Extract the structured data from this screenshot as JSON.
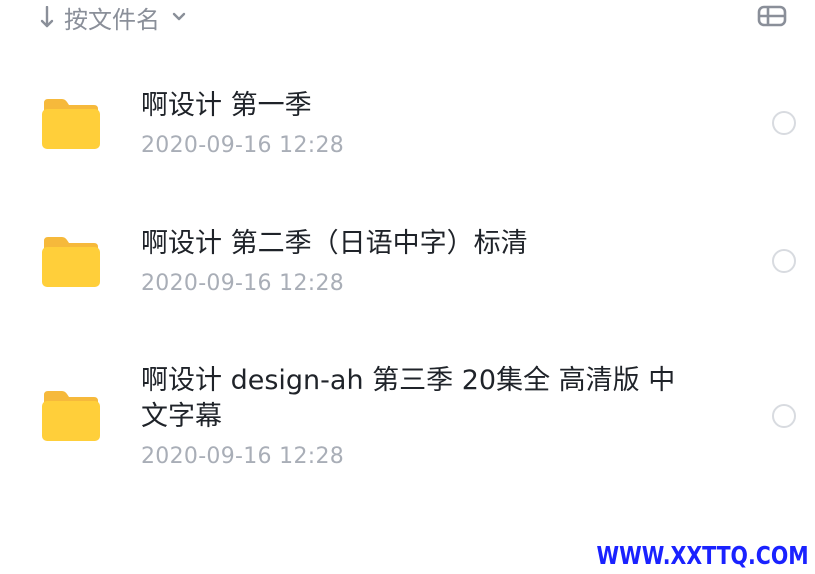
{
  "toolbar": {
    "sort_label": "按文件名",
    "sort_direction_icon": "arrow-down-icon",
    "sort_menu_icon": "chevron-down-icon",
    "view_toggle_icon": "list-view-icon"
  },
  "files": [
    {
      "name": "啊设计 第一季",
      "date": "2020-09-16 12:28",
      "icon": "folder-icon"
    },
    {
      "name": "啊设计 第二季（日语中字）标清",
      "date": "2020-09-16 12:28",
      "icon": "folder-icon"
    },
    {
      "name": "啊设计 design-ah 第三季 20集全 高清版 中文字幕",
      "date": "2020-09-16 12:28",
      "icon": "folder-icon"
    }
  ],
  "watermark": "WWW.XXTTQ.COM",
  "colors": {
    "folder": "#ffcf3a",
    "folder_tab": "#f6b93b",
    "text_primary": "#1f2329",
    "text_secondary": "#a9aeb7",
    "watermark": "#1a22ff"
  }
}
